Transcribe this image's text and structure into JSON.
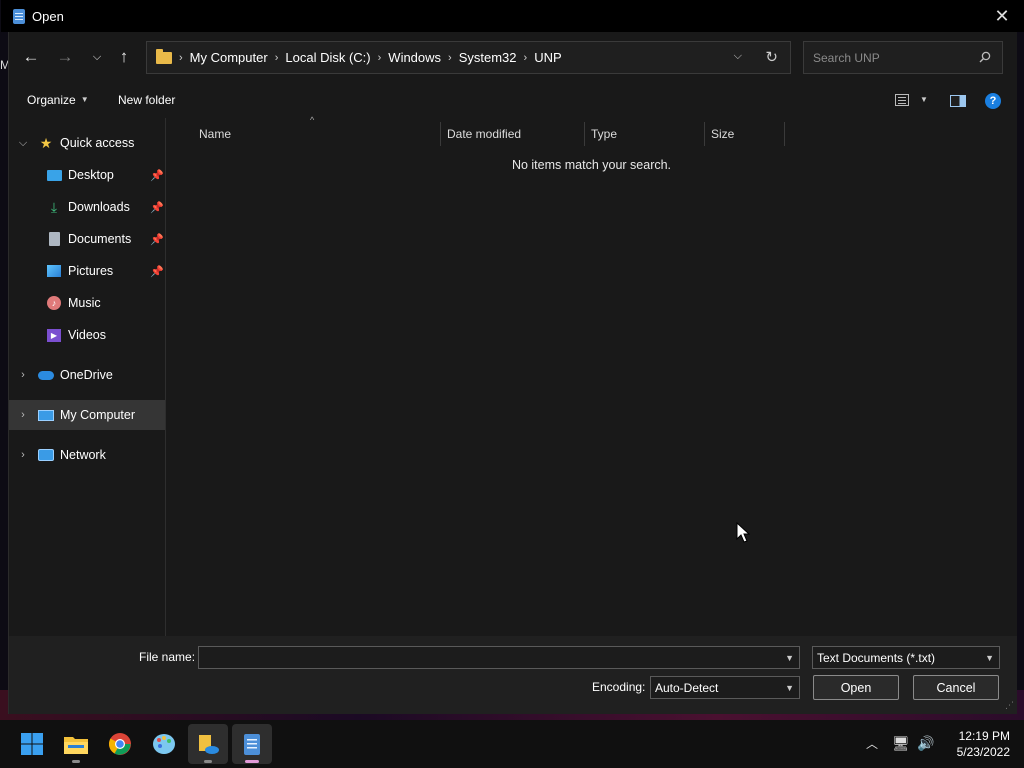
{
  "window": {
    "title": "Open"
  },
  "background": {
    "stray_glyph": "M"
  },
  "navigation": {
    "breadcrumb": [
      "My Computer",
      "Local Disk (C:)",
      "Windows",
      "System32",
      "UNP"
    ],
    "search_placeholder": "Search UNP"
  },
  "toolbar": {
    "organize_label": "Organize",
    "new_folder_label": "New folder",
    "help_label": "?"
  },
  "sidebar": {
    "items": [
      {
        "label": "Quick access"
      },
      {
        "label": "Desktop"
      },
      {
        "label": "Downloads"
      },
      {
        "label": "Documents"
      },
      {
        "label": "Pictures"
      },
      {
        "label": "Music"
      },
      {
        "label": "Videos"
      },
      {
        "label": "OneDrive"
      },
      {
        "label": "My Computer"
      },
      {
        "label": "Network"
      }
    ]
  },
  "file_list": {
    "columns": [
      "Name",
      "Date modified",
      "Type",
      "Size"
    ],
    "empty_message": "No items match your search."
  },
  "footer": {
    "file_name_label": "File name:",
    "file_name_value": "",
    "file_type_value": "Text Documents (*.txt)",
    "encoding_label": "Encoding:",
    "encoding_value": "Auto-Detect",
    "open_label": "Open",
    "cancel_label": "Cancel"
  },
  "taskbar": {
    "time": "12:19 PM",
    "date": "5/23/2022"
  }
}
